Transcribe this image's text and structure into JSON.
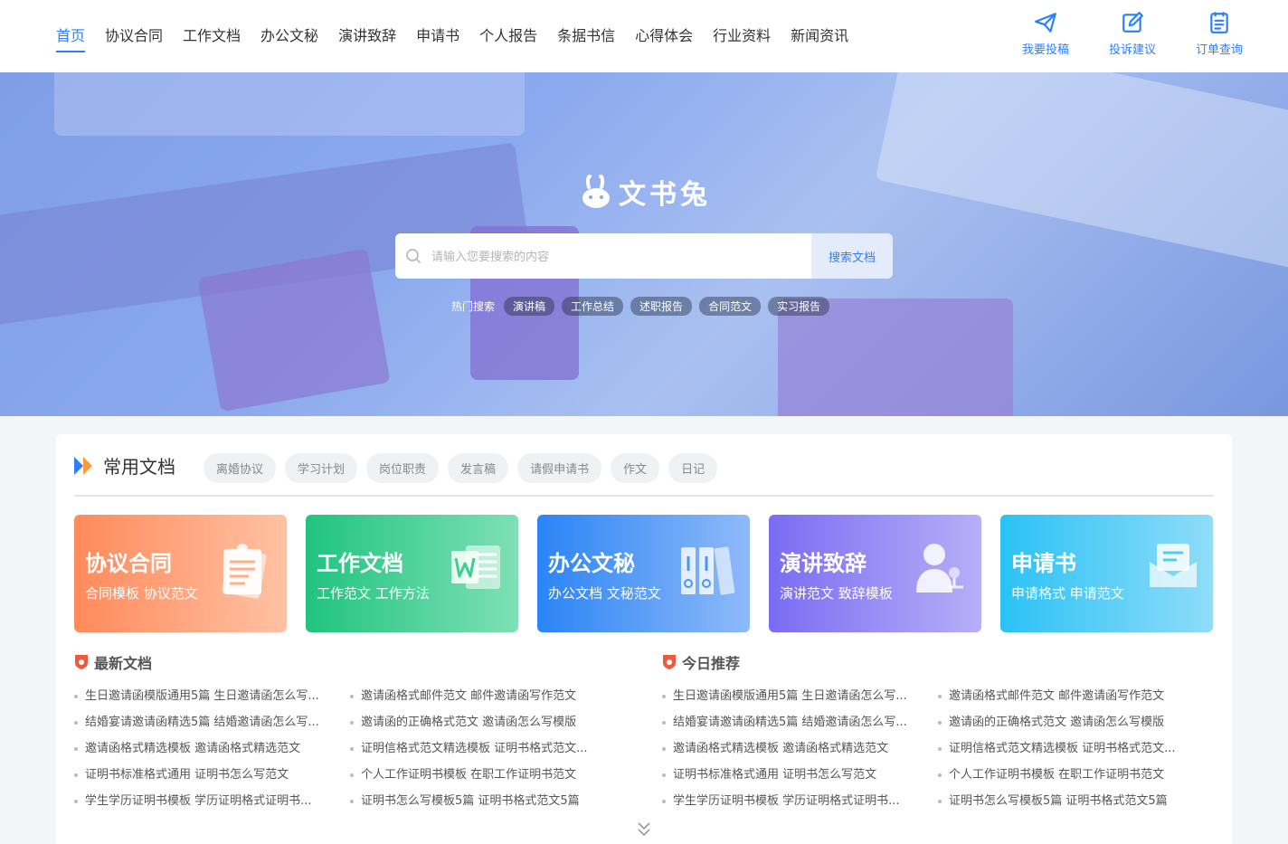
{
  "nav": [
    "首页",
    "协议合同",
    "工作文档",
    "办公文秘",
    "演讲致辞",
    "申请书",
    "个人报告",
    "条据书信",
    "心得体会",
    "行业资料",
    "新闻资讯"
  ],
  "actions": [
    {
      "label": "我要投稿",
      "icon": "paper-plane-icon"
    },
    {
      "label": "投诉建议",
      "icon": "edit-icon"
    },
    {
      "label": "订单查询",
      "icon": "order-list-icon"
    }
  ],
  "hero": {
    "logo_text": "文书兔",
    "search_placeholder": "请输入您要搜索的内容",
    "search_button": "搜索文档",
    "hot_label": "热门搜索",
    "hot_tags": [
      "演讲稿",
      "工作总结",
      "述职报告",
      "合同范文",
      "实习报告"
    ]
  },
  "common": {
    "title": "常用文档",
    "tags": [
      "离婚协议",
      "学习计划",
      "岗位职责",
      "发言稿",
      "请假申请书",
      "作文",
      "日记"
    ]
  },
  "cards": [
    {
      "title": "协议合同",
      "sub": "合同模板 协议范文",
      "icon": "contract-icon",
      "color_from": "#ff8a5b",
      "color_to": "#ffc2a4"
    },
    {
      "title": "工作文档",
      "sub": "工作范文 工作方法",
      "icon": "word-document-icon",
      "color_from": "#20c47f",
      "color_to": "#7fe0b6"
    },
    {
      "title": "办公文秘",
      "sub": "办公文档 文秘范文",
      "icon": "binders-icon",
      "color_from": "#2b84f6",
      "color_to": "#8fbaf8"
    },
    {
      "title": "演讲致辞",
      "sub": "演讲范文 致辞模板",
      "icon": "speaker-icon",
      "color_from": "#7a6cf2",
      "color_to": "#b7aff8"
    },
    {
      "title": "申请书",
      "sub": "申请格式 申请范文",
      "icon": "envelope-icon",
      "color_from": "#2bc2f5",
      "color_to": "#8fdcf9"
    }
  ],
  "latest": {
    "title": "最新文档",
    "items": [
      "生日邀请函模版通用5篇 生日邀请函怎么写...",
      "邀请函格式邮件范文 邮件邀请函写作范文",
      "结婚宴请邀请函精选5篇 结婚邀请函怎么写...",
      "邀请函的正确格式范文 邀请函怎么写模版",
      "邀请函格式精选模板 邀请函格式精选范文",
      "证明信格式范文精选模板 证明书格式范文...",
      "证明书标准格式通用 证明书怎么写范文",
      "个人工作证明书模板 在职工作证明书范文",
      "学生学历证明书模板 学历证明格式证明书...",
      "证明书怎么写模板5篇 证明书格式范文5篇"
    ]
  },
  "today": {
    "title": "今日推荐",
    "items": [
      "生日邀请函模版通用5篇 生日邀请函怎么写...",
      "邀请函格式邮件范文 邮件邀请函写作范文",
      "结婚宴请邀请函精选5篇 结婚邀请函怎么写...",
      "邀请函的正确格式范文 邀请函怎么写模版",
      "邀请函格式精选模板 邀请函格式精选范文",
      "证明信格式范文精选模板 证明书格式范文...",
      "证明书标准格式通用 证明书怎么写范文",
      "个人工作证明书模板 在职工作证明书范文",
      "学生学历证明书模板 学历证明格式证明书...",
      "证明书怎么写模板5篇 证明书格式范文5篇"
    ]
  },
  "colors": {
    "accent": "#2d7ff9",
    "badge": "#f05a3c"
  }
}
